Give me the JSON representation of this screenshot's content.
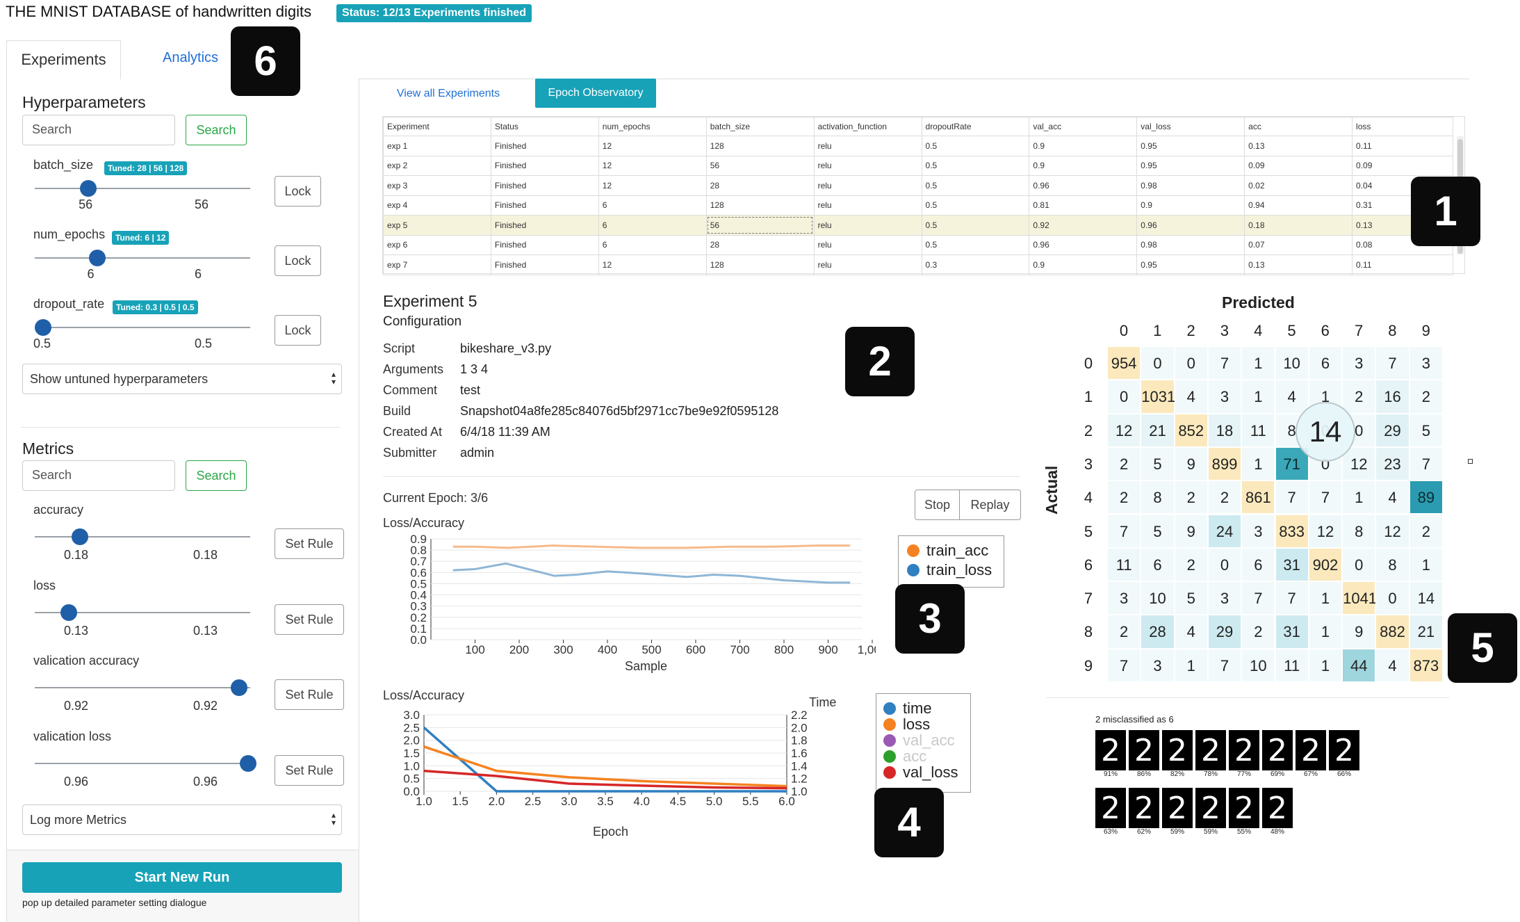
{
  "app": {
    "title": "THE MNIST DATABASE of handwritten digits",
    "status": "Status: 12/13 Experiments finished"
  },
  "tabs": {
    "experiments": "Experiments",
    "analytics": "Analytics"
  },
  "callouts": [
    "1",
    "2",
    "3",
    "4",
    "5",
    "6"
  ],
  "hyperparameters": {
    "title": "Hyperparameters",
    "search_placeholder": "Search",
    "search_button": "Search",
    "params": [
      {
        "name": "batch_size",
        "tuned": "Tuned: 28 | 56 | 128",
        "min_val": "56",
        "max_val": "56",
        "level": 0.21,
        "button": "Lock"
      },
      {
        "name": "num_epochs",
        "tuned": "Tuned: 6 | 12",
        "min_val": "6",
        "max_val": "6",
        "level": 0.25,
        "button": "Lock"
      },
      {
        "name": "dropout_rate",
        "tuned": "Tuned: 0.3 | 0.5 | 0.5",
        "min_val": "0.5",
        "max_val": "0.5",
        "level": 0.0,
        "button": "Lock"
      }
    ],
    "show_untuned": "Show untuned hyperparameters"
  },
  "metrics": {
    "title": "Metrics",
    "search_placeholder": "Search",
    "search_button": "Search",
    "items": [
      {
        "name": "accuracy",
        "min_val": "0.18",
        "max_val": "0.18",
        "level": 0.18,
        "button": "Set Rule"
      },
      {
        "name": "loss",
        "min_val": "0.13",
        "max_val": "0.13",
        "level": 0.13,
        "button": "Set Rule"
      },
      {
        "name": "valication accuracy",
        "min_val": "0.92",
        "max_val": "0.92",
        "level": 0.92,
        "button": "Set Rule"
      },
      {
        "name": "valication loss",
        "min_val": "0.96",
        "max_val": "0.96",
        "level": 0.96,
        "button": "Set Rule"
      }
    ],
    "log_more": "Log more Metrics"
  },
  "actions": {
    "start_run": "Start New Run",
    "start_run_hint": "pop up detailed parameter setting dialogue"
  },
  "views": {
    "view_all": "View all Experiments",
    "epoch_observatory": "Epoch Observatory"
  },
  "experiments_table": {
    "columns": [
      "Experiment",
      "Status",
      "num_epochs",
      "batch_size",
      "activation_function",
      "dropoutRate",
      "val_acc",
      "val_loss",
      "acc",
      "loss"
    ],
    "rows": [
      [
        "exp 1",
        "Finished",
        "12",
        "128",
        "relu",
        "0.5",
        "0.9",
        "0.95",
        "0.13",
        "0.11"
      ],
      [
        "exp 2",
        "Finished",
        "12",
        "56",
        "relu",
        "0.5",
        "0.9",
        "0.95",
        "0.09",
        "0.09"
      ],
      [
        "exp 3",
        "Finished",
        "12",
        "28",
        "relu",
        "0.5",
        "0.96",
        "0.98",
        "0.02",
        "0.04"
      ],
      [
        "exp 4",
        "Finished",
        "6",
        "128",
        "relu",
        "0.5",
        "0.81",
        "0.9",
        "0.94",
        "0.31"
      ],
      [
        "exp 5",
        "Finished",
        "6",
        "56",
        "relu",
        "0.5",
        "0.92",
        "0.96",
        "0.18",
        "0.13"
      ],
      [
        "exp 6",
        "Finished",
        "6",
        "28",
        "relu",
        "0.5",
        "0.96",
        "0.98",
        "0.07",
        "0.08"
      ],
      [
        "exp 7",
        "Finished",
        "12",
        "128",
        "relu",
        "0.3",
        "0.9",
        "0.95",
        "0.13",
        "0.11"
      ]
    ],
    "selected_row": 4
  },
  "experiment_detail": {
    "title": "Experiment 5",
    "subtitle": "Configuration",
    "fields": [
      {
        "key": "Script",
        "value": "bikeshare_v3.py"
      },
      {
        "key": "Arguments",
        "value": "1 3 4"
      },
      {
        "key": "Comment",
        "value": "test"
      },
      {
        "key": "Build",
        "value": "Snapshot04a8fe285c84076d5bf2971cc7be9e92f0595128"
      },
      {
        "key": "Created At",
        "value": "6/4/18 11:39 AM"
      },
      {
        "key": "Submitter",
        "value": "admin"
      }
    ]
  },
  "epoch_controls": {
    "current_epoch": "Current Epoch: 3/6",
    "stop": "Stop",
    "replay": "Replay"
  },
  "colors": {
    "accent": "#17a2b8",
    "knob": "#1f5fa8",
    "orange": "#f39a4a",
    "blue": "#2f7fc1",
    "purple": "#9b59b6",
    "green": "#2ca02c",
    "red": "#d62728"
  },
  "chart_data": [
    {
      "type": "line",
      "title": "Loss/Accuracy",
      "xlabel": "Sample",
      "ylabel": "",
      "xlim": [
        0,
        1000
      ],
      "ylim": [
        0,
        0.9
      ],
      "xticks": [
        "100",
        "200",
        "300",
        "400",
        "500",
        "600",
        "700",
        "800",
        "900",
        "1,000"
      ],
      "yticks": [
        "0.0",
        "0.1",
        "0.2",
        "0.3",
        "0.4",
        "0.5",
        "0.6",
        "0.7",
        "0.8",
        "0.9"
      ],
      "series": [
        {
          "name": "train_acc",
          "color": "#f7b98a",
          "x": [
            50,
            100,
            175,
            275,
            375,
            475,
            575,
            675,
            775,
            875,
            950
          ],
          "y": [
            0.83,
            0.83,
            0.82,
            0.84,
            0.83,
            0.82,
            0.82,
            0.83,
            0.83,
            0.84,
            0.84
          ]
        },
        {
          "name": "train_loss",
          "color": "#8fb6d6",
          "x": [
            50,
            100,
            170,
            280,
            330,
            400,
            480,
            580,
            640,
            700,
            800,
            900,
            950
          ],
          "y": [
            0.62,
            0.63,
            0.68,
            0.57,
            0.58,
            0.61,
            0.59,
            0.56,
            0.58,
            0.57,
            0.53,
            0.51,
            0.51
          ]
        }
      ],
      "legend_position": "right"
    },
    {
      "type": "line",
      "title": "Loss/Accuracy",
      "xlabel": "Epoch",
      "ylabel": "",
      "right_axis_label": "Time",
      "xlim": [
        1.0,
        6.0
      ],
      "ylim": [
        0,
        3.0
      ],
      "y2lim": [
        1.0,
        2.2
      ],
      "xticks": [
        "1.0",
        "1.5",
        "2.0",
        "2.5",
        "3.0",
        "3.5",
        "4.0",
        "4.5",
        "5.0",
        "5.5",
        "6.0"
      ],
      "yticks": [
        "0.0",
        "0.5",
        "1.0",
        "1.5",
        "2.0",
        "2.5",
        "3.0"
      ],
      "y2ticks": [
        "1.0",
        "1.2",
        "1.4",
        "1.6",
        "1.8",
        "2.0",
        "2.2"
      ],
      "series": [
        {
          "name": "time",
          "color": "#2f7fc1",
          "x": [
            1.0,
            2.0,
            3.0,
            4.0,
            5.0,
            6.0
          ],
          "y": [
            2.5,
            0.0,
            0.0,
            0.0,
            0.0,
            0.0
          ]
        },
        {
          "name": "loss",
          "color": "#f58220",
          "x": [
            1.0,
            2.0,
            3.0,
            4.0,
            5.0,
            6.0
          ],
          "y": [
            1.75,
            0.8,
            0.55,
            0.4,
            0.3,
            0.2
          ]
        },
        {
          "name": "val_acc",
          "color": "#9b59b6",
          "x": [],
          "y": [],
          "disabled": true
        },
        {
          "name": "acc",
          "color": "#2ca02c",
          "x": [],
          "y": [],
          "disabled": true
        },
        {
          "name": "val_loss",
          "color": "#d62728",
          "x": [
            1.0,
            2.0,
            3.0,
            4.0,
            5.0,
            6.0
          ],
          "y": [
            0.8,
            0.6,
            0.3,
            0.22,
            0.15,
            0.12
          ]
        }
      ],
      "legend_position": "right"
    },
    {
      "type": "heatmap",
      "title": "Predicted",
      "ylabel": "Actual",
      "categories": [
        "0",
        "1",
        "2",
        "3",
        "4",
        "5",
        "6",
        "7",
        "8",
        "9"
      ],
      "values": [
        [
          954,
          0,
          0,
          7,
          1,
          10,
          6,
          3,
          7,
          3
        ],
        [
          0,
          1031,
          4,
          3,
          1,
          4,
          1,
          2,
          16,
          2
        ],
        [
          12,
          21,
          852,
          18,
          11,
          8,
          0,
          0,
          29,
          5
        ],
        [
          2,
          5,
          9,
          899,
          1,
          71,
          0,
          12,
          23,
          7
        ],
        [
          2,
          8,
          2,
          2,
          861,
          7,
          7,
          1,
          4,
          89
        ],
        [
          7,
          5,
          9,
          24,
          3,
          833,
          12,
          8,
          12,
          2
        ],
        [
          11,
          6,
          2,
          0,
          6,
          31,
          902,
          0,
          8,
          1
        ],
        [
          3,
          10,
          5,
          3,
          7,
          7,
          1,
          1041,
          0,
          14
        ],
        [
          2,
          28,
          4,
          29,
          2,
          31,
          1,
          9,
          882,
          21
        ],
        [
          7,
          3,
          1,
          7,
          10,
          11,
          1,
          44,
          4,
          873
        ]
      ],
      "highlight_value": "14"
    }
  ],
  "misclassified": {
    "label": "2 misclassified as 6",
    "row1": [
      "91%",
      "86%",
      "82%",
      "78%",
      "77%",
      "69%",
      "67%",
      "66%"
    ],
    "row2": [
      "63%",
      "62%",
      "59%",
      "59%",
      "55%",
      "48%"
    ]
  }
}
